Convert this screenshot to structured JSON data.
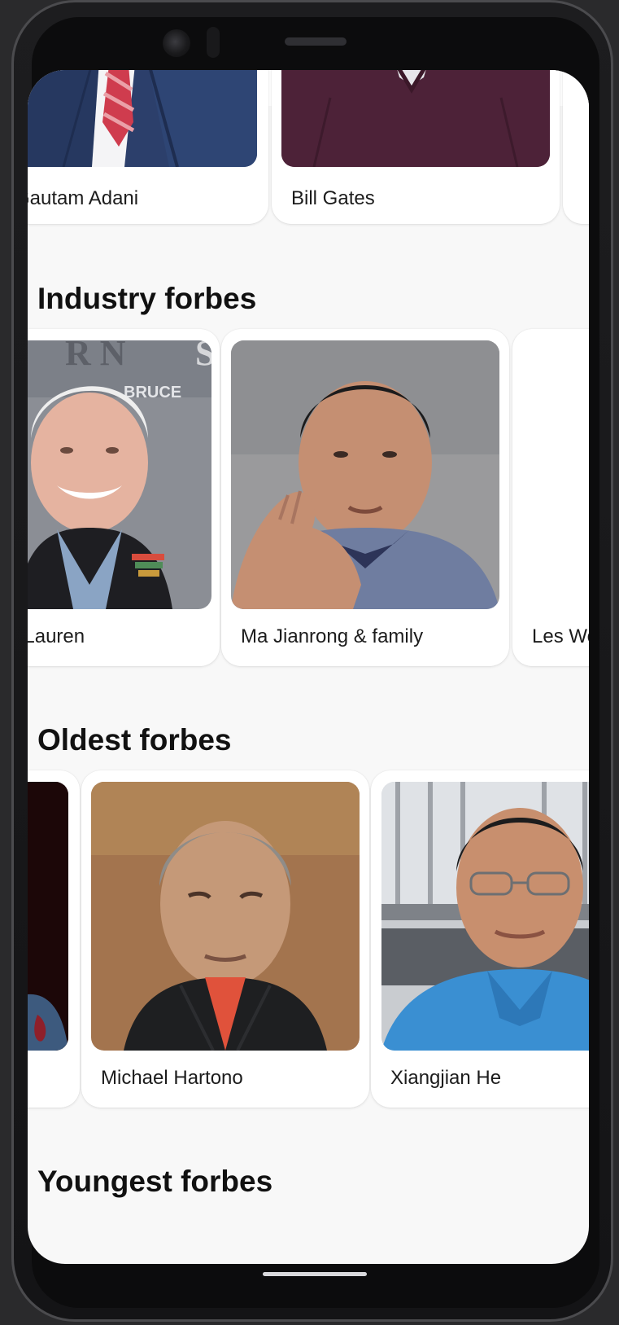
{
  "sections": {
    "top_row": {
      "cards": [
        {
          "name": "Gautam Adani"
        },
        {
          "name": "Bill Gates"
        }
      ]
    },
    "industry": {
      "title": "Industry forbes",
      "cards": [
        {
          "name": "Ralph Lauren"
        },
        {
          "name": "Ma Jianrong & family"
        },
        {
          "name": "Les Wexner"
        }
      ]
    },
    "oldest": {
      "title": "Oldest forbes",
      "cards": [
        {
          "name": ""
        },
        {
          "name": "Michael Hartono"
        },
        {
          "name": "Xiangjian He"
        }
      ]
    },
    "youngest": {
      "title": "Youngest forbes"
    }
  },
  "photo_text": {
    "backdrop_word": "BRUCE"
  },
  "colors": {
    "background": "#f8f8f8",
    "card": "#ffffff",
    "text": "#111111"
  }
}
